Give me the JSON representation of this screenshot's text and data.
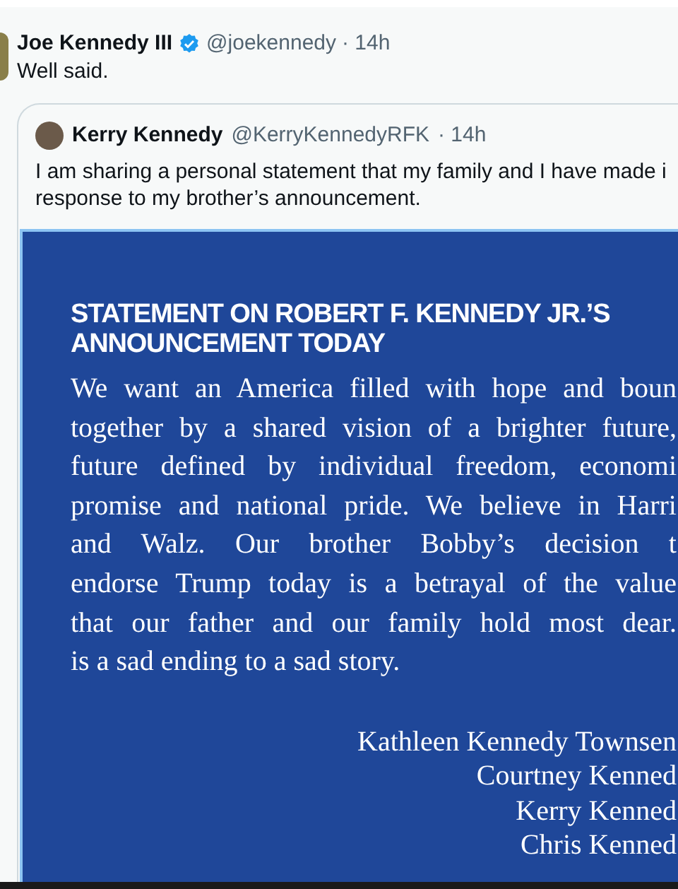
{
  "tweet": {
    "name": "Joe Kennedy III",
    "verified": true,
    "handle": "@joekennedy",
    "time": "· 14h",
    "text": "Well said."
  },
  "quoted": {
    "name": "Kerry Kennedy",
    "handle": "@KerryKennedyRFK",
    "time": "· 14h",
    "text_lines": [
      "I am sharing a personal statement that my family and I have made i",
      "response to my brother’s announcement."
    ],
    "image": {
      "heading_lines": [
        "STATEMENT ON ROBERT F. KENNEDY JR.’S",
        "ANNOUNCEMENT TODAY"
      ],
      "body_lines": [
        "We want an America filled with hope and boun",
        "together by a shared vision of a brighter future,",
        "future defined by individual freedom, economi",
        "promise and national pride. We believe in Harri",
        "and Walz. Our brother Bobby’s decision t",
        "endorse Trump today is a betrayal of the value",
        "that our father and our family hold most dear.",
        "is a sad ending to a sad story."
      ],
      "signatures": [
        "Kathleen Kennedy Townsen",
        "Courtney Kenned",
        "Kerry Kenned",
        "Chris Kenned"
      ]
    }
  }
}
